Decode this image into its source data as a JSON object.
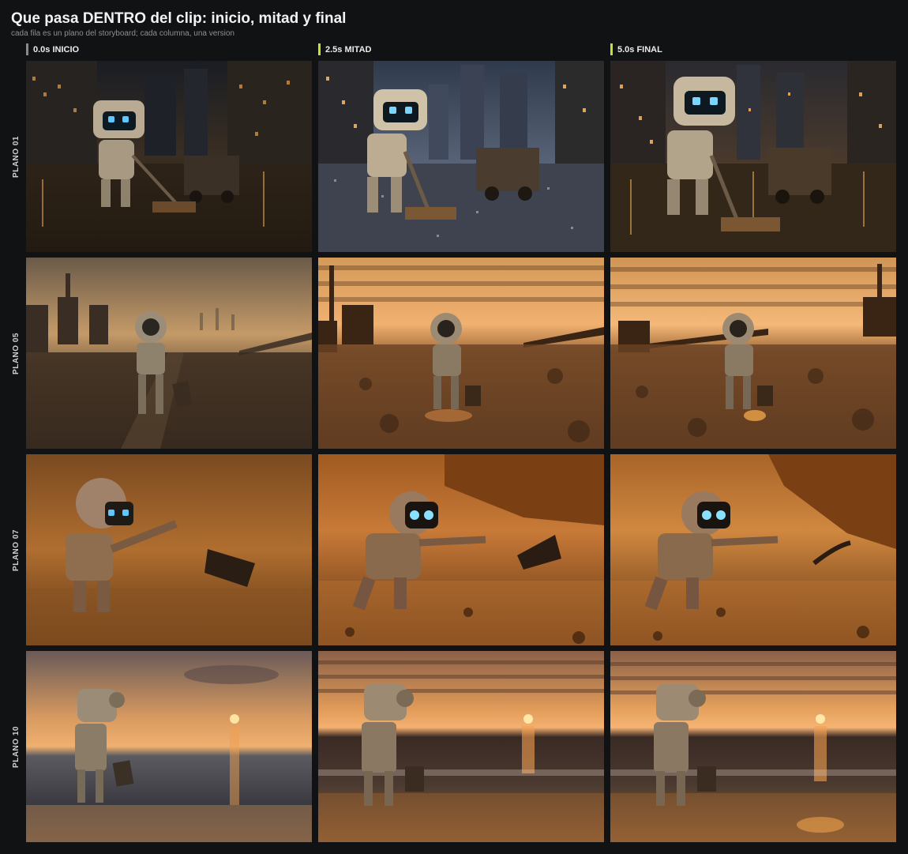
{
  "header": {
    "title": "Que pasa DENTRO del clip: inicio, mitad y final",
    "subtitle": "cada fila es un plano del storyboard; cada columna, una version"
  },
  "columns": [
    {
      "label": "0.0s INICIO",
      "marker_color": "#8a8a8a"
    },
    {
      "label": "2.5s MITAD",
      "marker_color": "#c6e03a"
    },
    {
      "label": "5.0s FINAL",
      "marker_color": "#c6e03a"
    }
  ],
  "rows": [
    {
      "label": "PLANO 01",
      "scene": "night-city-sweeping"
    },
    {
      "label": "PLANO 05",
      "scene": "wasteland-walking"
    },
    {
      "label": "PLANO 07",
      "scene": "desert-reaching"
    },
    {
      "label": "PLANO 10",
      "scene": "beach-sunset"
    }
  ]
}
